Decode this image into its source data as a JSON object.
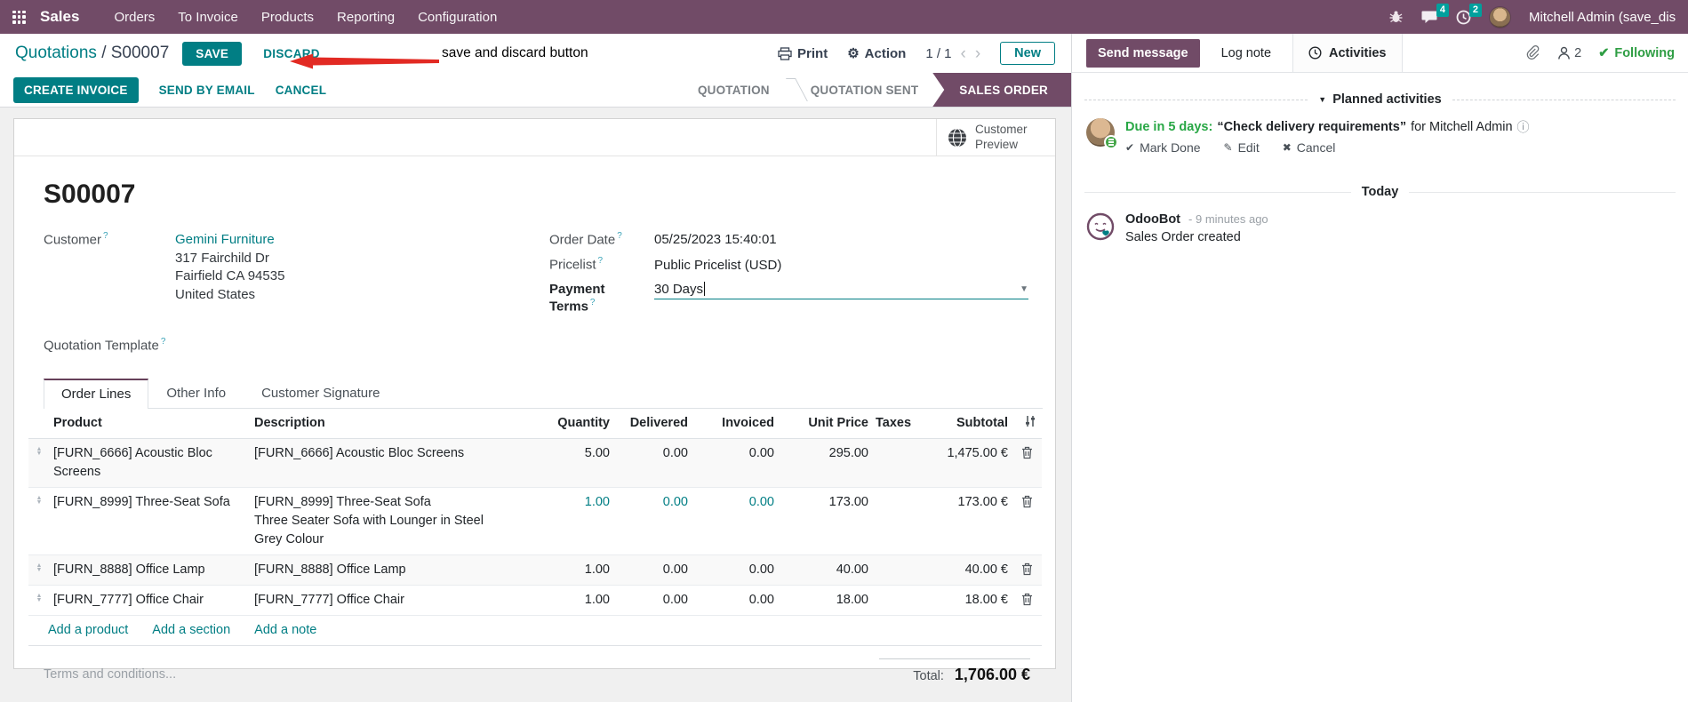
{
  "colors": {
    "brand": "#714B67",
    "accent": "#017e84",
    "success": "#28a745",
    "badge": "#00A09D",
    "annotation_red": "#e22a23"
  },
  "nav": {
    "app_name": "Sales",
    "menus": [
      "Orders",
      "To Invoice",
      "Products",
      "Reporting",
      "Configuration"
    ],
    "message_badge": "4",
    "activity_badge": "2",
    "user_name": "Mitchell Admin (save_discar"
  },
  "control_panel": {
    "breadcrumb_parent": "Quotations",
    "breadcrumb_separator": "/",
    "breadcrumb_current": "S00007",
    "save_label": "SAVE",
    "discard_label": "DISCARD",
    "print_label": "Print",
    "action_label": "Action",
    "pager_value": "1 / 1",
    "new_label": "New"
  },
  "annotation": {
    "text": "save and discard button"
  },
  "statusbar": {
    "create_invoice": "CREATE INVOICE",
    "send_by_email": "SEND BY EMAIL",
    "cancel": "CANCEL",
    "states": {
      "quotation": "QUOTATION",
      "quotation_sent": "QUOTATION SENT",
      "sales_order": "SALES ORDER"
    }
  },
  "sheet": {
    "customer_preview": "Customer Preview",
    "name": "S00007",
    "customer_label": "Customer",
    "customer_name": "Gemini Furniture",
    "address_line1": "317 Fairchild Dr",
    "address_line2": "Fairfield CA 94535",
    "address_line3": "United States",
    "quotation_template_label": "Quotation Template",
    "order_date_label": "Order Date",
    "order_date": "05/25/2023 15:40:01",
    "pricelist_label": "Pricelist",
    "pricelist": "Public Pricelist (USD)",
    "payment_terms_label": "Payment Terms",
    "payment_terms": "30 Days",
    "tabs": {
      "order_lines": "Order Lines",
      "other_info": "Other Info",
      "customer_signature": "Customer Signature"
    },
    "terms_placeholder": "Terms and conditions..."
  },
  "table": {
    "headers": {
      "product": "Product",
      "description": "Description",
      "quantity": "Quantity",
      "delivered": "Delivered",
      "invoiced": "Invoiced",
      "unit_price": "Unit Price",
      "taxes": "Taxes",
      "subtotal": "Subtotal"
    },
    "rows": [
      {
        "product": "[FURN_6666] Acoustic Bloc Screens",
        "description": "[FURN_6666] Acoustic Bloc Screens",
        "description2": "",
        "quantity": "5.00",
        "delivered": "0.00",
        "invoiced": "0.00",
        "unit_price": "295.00",
        "taxes": "",
        "subtotal": "1,475.00 €"
      },
      {
        "product": "[FURN_8999] Three-Seat Sofa",
        "description": "[FURN_8999] Three-Seat Sofa",
        "description2": "Three Seater Sofa with Lounger in Steel Grey Colour",
        "quantity": "1.00",
        "delivered": "0.00",
        "invoiced": "0.00",
        "unit_price": "173.00",
        "taxes": "",
        "subtotal": "173.00 €"
      },
      {
        "product": "[FURN_8888] Office Lamp",
        "description": "[FURN_8888] Office Lamp",
        "description2": "",
        "quantity": "1.00",
        "delivered": "0.00",
        "invoiced": "0.00",
        "unit_price": "40.00",
        "taxes": "",
        "subtotal": "40.00 €"
      },
      {
        "product": "[FURN_7777] Office Chair",
        "description": "[FURN_7777] Office Chair",
        "description2": "",
        "quantity": "1.00",
        "delivered": "0.00",
        "invoiced": "0.00",
        "unit_price": "18.00",
        "taxes": "",
        "subtotal": "18.00 €"
      }
    ],
    "add_product": "Add a product",
    "add_section": "Add a section",
    "add_note": "Add a note",
    "total_label": "Total:",
    "total_value": "1,706.00 €"
  },
  "chatter": {
    "send_message": "Send message",
    "log_note": "Log note",
    "activities": "Activities",
    "followers_count": "2",
    "following": "Following",
    "planned_section": "Planned activities",
    "activity": {
      "due": "Due in 5 days:",
      "summary": "“Check delivery requirements”",
      "for_text": "for Mitchell Admin",
      "mark_done": "Mark Done",
      "edit": "Edit",
      "cancel": "Cancel"
    },
    "today": "Today",
    "message": {
      "author": "OdooBot",
      "time": "- 9 minutes ago",
      "body": "Sales Order created"
    }
  }
}
